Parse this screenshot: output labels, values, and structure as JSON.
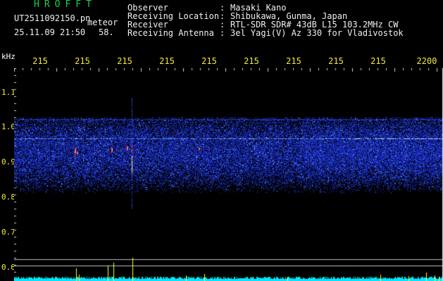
{
  "logo": "HROFFT",
  "header": {
    "labels": [
      "Observer",
      "Receiving Location",
      "Receiver",
      "Receiving Antenna"
    ],
    "values": [
      "Masaki Kano",
      "Shibukawa, Gunma, Japan",
      "RTL-SDR SDR# 43dB L15 103.2MHz CW",
      "3el Yagi(V) Az 330 for Vladivostok"
    ]
  },
  "file": {
    "name": "UT2511092150.pn",
    "type_label": "meteor",
    "datetime": "25.11.09 21:50",
    "count": "58."
  },
  "yaxis": {
    "unit": "kHz",
    "ticks": [
      "1.1",
      "1.0",
      "0.9",
      "0.8",
      "0.7",
      "0.6"
    ]
  },
  "xaxis": {
    "ticks": [
      "215",
      "215",
      "215",
      "215",
      "215",
      "215",
      "215",
      "215",
      "215",
      "2200"
    ]
  },
  "colors": {
    "logo": "#18d24a",
    "tick_text": "#f2ea3a",
    "noise_band": "#1f3cff",
    "carrier": "#a0c8ff",
    "meteor_red": "#ff4a4a",
    "meteor_yellow": "#ffff30",
    "baseline": "#00e8ff"
  }
}
